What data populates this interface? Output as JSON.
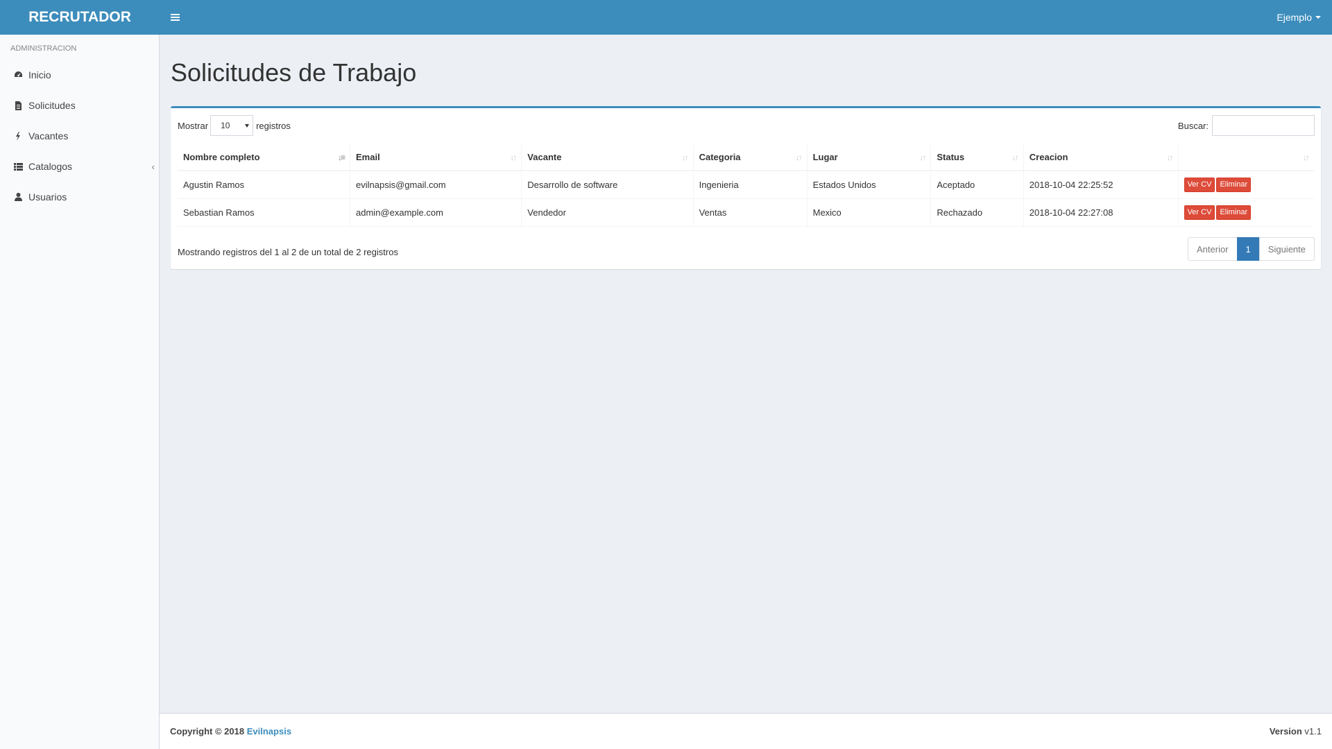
{
  "header": {
    "logo": "RECRUTADOR",
    "user_name": "Ejemplo"
  },
  "sidebar": {
    "section_title": "ADMINISTRACION",
    "items": [
      {
        "label": "Inicio",
        "icon": "dashboard-icon"
      },
      {
        "label": "Solicitudes",
        "icon": "file-icon"
      },
      {
        "label": "Vacantes",
        "icon": "bolt-icon"
      },
      {
        "label": "Catalogos",
        "icon": "list-icon"
      },
      {
        "label": "Usuarios",
        "icon": "user-icon"
      }
    ]
  },
  "main": {
    "title": "Solicitudes de Trabajo",
    "length": {
      "prefix": "Mostrar",
      "value": "10",
      "suffix": "registros"
    },
    "search": {
      "label": "Buscar:",
      "value": ""
    },
    "table": {
      "columns": [
        "Nombre completo",
        "Email",
        "Vacante",
        "Categoria",
        "Lugar",
        "Status",
        "Creacion",
        ""
      ],
      "rows": [
        {
          "nombre": "Agustin Ramos",
          "email": "evilnapsis@gmail.com",
          "vacante": "Desarrollo de software",
          "categoria": "Ingenieria",
          "lugar": "Estados Unidos",
          "status": "Aceptado",
          "creacion": "2018-10-04 22:25:52"
        },
        {
          "nombre": "Sebastian Ramos",
          "email": "admin@example.com",
          "vacante": "Vendedor",
          "categoria": "Ventas",
          "lugar": "Mexico",
          "status": "Rechazado",
          "creacion": "2018-10-04 22:27:08"
        }
      ],
      "actions": {
        "view_cv": "Ver CV",
        "delete": "Eliminar"
      }
    },
    "info": "Mostrando registros del 1 al 2 de un total de 2 registros",
    "pagination": {
      "prev": "Anterior",
      "current": "1",
      "next": "Siguiente"
    }
  },
  "footer": {
    "copyright": "Copyright © 2018",
    "company": "Evilnapsis",
    "version_label": "Version",
    "version": "v1.1"
  },
  "colors": {
    "header": "#3c8dbc",
    "danger": "#dd4b39",
    "primary": "#337ab7"
  }
}
